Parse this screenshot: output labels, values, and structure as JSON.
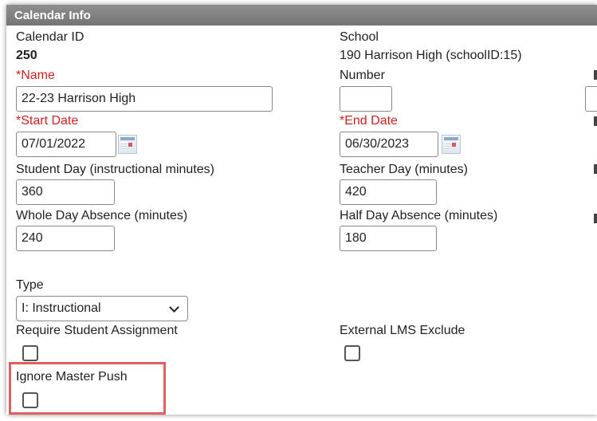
{
  "header": {
    "title": "Calendar Info"
  },
  "calendar_id": {
    "label": "Calendar ID",
    "value": "250"
  },
  "school": {
    "label": "School",
    "value": "190 Harrison High (schoolID:15)"
  },
  "name": {
    "label": "*Name",
    "value": "22-23 Harrison High"
  },
  "number": {
    "label": "Number",
    "value": ""
  },
  "start_date": {
    "label": "*Start Date",
    "value": "07/01/2022"
  },
  "end_date": {
    "label": "*End Date",
    "value": "06/30/2023"
  },
  "student_day": {
    "label": "Student Day (instructional minutes)",
    "value": "360"
  },
  "teacher_day": {
    "label": "Teacher Day (minutes)",
    "value": "420"
  },
  "whole_day_absence": {
    "label": "Whole Day Absence (minutes)",
    "value": "240"
  },
  "half_day_absence": {
    "label": "Half Day Absence (minutes)",
    "value": "180"
  },
  "type": {
    "label": "Type",
    "selected": "I: Instructional"
  },
  "require_student_assignment": {
    "label": "Require Student Assignment",
    "checked": false
  },
  "external_lms_exclude": {
    "label": "External LMS Exclude",
    "checked": false
  },
  "ignore_master_push": {
    "label": "Ignore Master Push",
    "checked": false
  },
  "colors": {
    "header_bg": "#808080",
    "required_label": "#d42020",
    "highlight_border": "#e0605f"
  },
  "icons": [
    "calendar-icon",
    "chevron-down-icon"
  ]
}
